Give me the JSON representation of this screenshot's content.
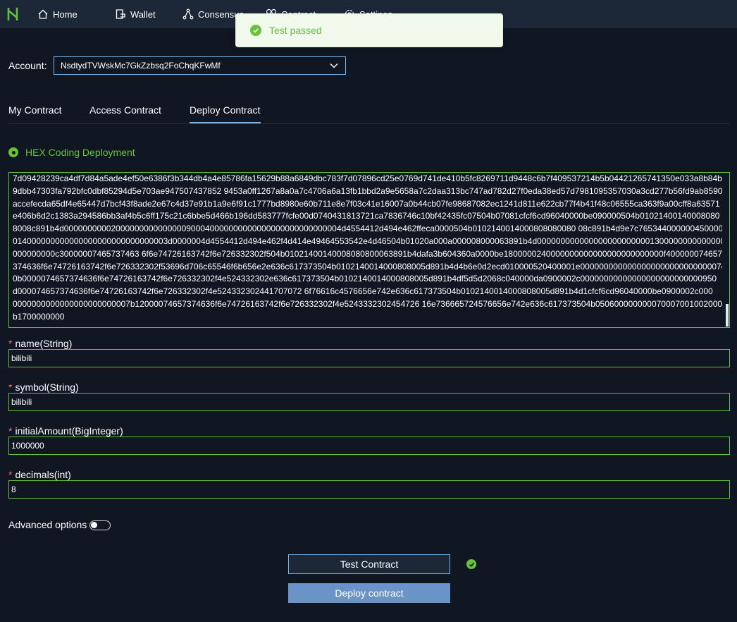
{
  "nav": {
    "items": [
      {
        "label": "Home",
        "icon": "home-icon"
      },
      {
        "label": "Wallet",
        "icon": "wallet-icon"
      },
      {
        "label": "Consensus",
        "icon": "consensus-icon"
      },
      {
        "label": "Contract",
        "icon": "contract-icon"
      },
      {
        "label": "Settings",
        "icon": "gear-icon"
      }
    ]
  },
  "toast": {
    "message": "Test passed",
    "color": "#67c23a"
  },
  "account": {
    "label": "Account:",
    "value": "NsdtydTVWskMc7GkZzbsq2FoChqKFwMf"
  },
  "tabs": [
    "My Contract",
    "Access Contract",
    "Deploy Contract"
  ],
  "deploy_mode": {
    "label": "HEX Coding Deployment"
  },
  "hex_code": [
    "7d09428239ca4df7d84a5ade4ef50e6386f3b344db4a4e85786fa15629b88a6849dbc783f7d07896cd25e0769d741de410b5fc8269711d9448c6b7f409537214b5b04421265741350e033a8b84b",
    "9dbb47303fa792bfc0dbf85294d5e703ae947507437852 9453a0ff1267a8a0a7c4706a6a13fb1bbd2a9e5658a7c2daa313bc747ad782d27f0eda38ed57d7981095357030a3cd277b56fd9ab8590",
    "accefecda65df4e65447d7bcf43f8ade2e67c4d37e91b1a9e6f91c1777bd8980e60b711e8e7f03c41e16007a0b44cb07fe98687082ec1241d811e622cb77f4b41f48c06555ca363f9a00cff8a63571",
    "e406b6d2c1383a294586bb3af4b5c6ff175c21c6bbe5d466b196dd583777fcfe00d0740431813721ca7836746c10bf42435fc07504b07081cfcf6cd96040000be090000504b01021400140008080",
    "8008c891b4d00000000002000000000000000900040000000000000000000000000004d4554412d494e462ffeca0000504b0102140014000808080080 08c891b4d9e7c76534400000045000000",
    "014000000000000000000000000000003d0000004d4554412d494e462f4d414e49464553542e4d46504b01020a000a000008000063891b4d00000000000000000000000013000000000000000",
    "000000000c30000007465737463 6f6e74726163742f6e726332302f504b01021400140008080800063891b4dafa3b604360a0000be1800000240000000000000000000000000f400000074657",
    "374636f6e74726163742f6e726332302f53696d706c65546f6b656e2e636c617373504b0102140014000808005d891b4d4b6e0d2ecd010000520400001e000000000000000000000000000007c",
    "0b0000074657374636f6e74726163742f6e726332302f4e524332302e636c617373504b0102140014000808005d891b4df5d5d2068c040000da0900002c00000000000000000000000000950",
    "d000074657374636f6e74726163742f6e726332302f4e524332302441707072 6f76616c4576656e742e636c617373504b0102140014000808005d891b4d1cfcf6cd96040000be0900002c000",
    "0000000000000000000000007b12000074657374636f6e74726163742f6e726332302f4e5243332302454726 16e736665724576656e742e636c617373504b050600000000070007001002000 06",
    "b1700000000"
  ],
  "fields": [
    {
      "label": "name(String)",
      "value": "bilibili"
    },
    {
      "label": "symbol(String)",
      "value": "bilibili"
    },
    {
      "label": "initialAmount(BigInteger)",
      "value": "1000000"
    },
    {
      "label": "decimals(int)",
      "value": "8"
    }
  ],
  "advanced": {
    "label": "Advanced options",
    "enabled": false
  },
  "buttons": {
    "test": "Test Contract",
    "deploy": "Deploy contract"
  },
  "colors": {
    "accent": "#7bb5e8",
    "success": "#67c23a",
    "background": "#101723",
    "topbar": "#1c2738",
    "deploy_button": "#6a93c8",
    "required": "#f56c6c"
  }
}
